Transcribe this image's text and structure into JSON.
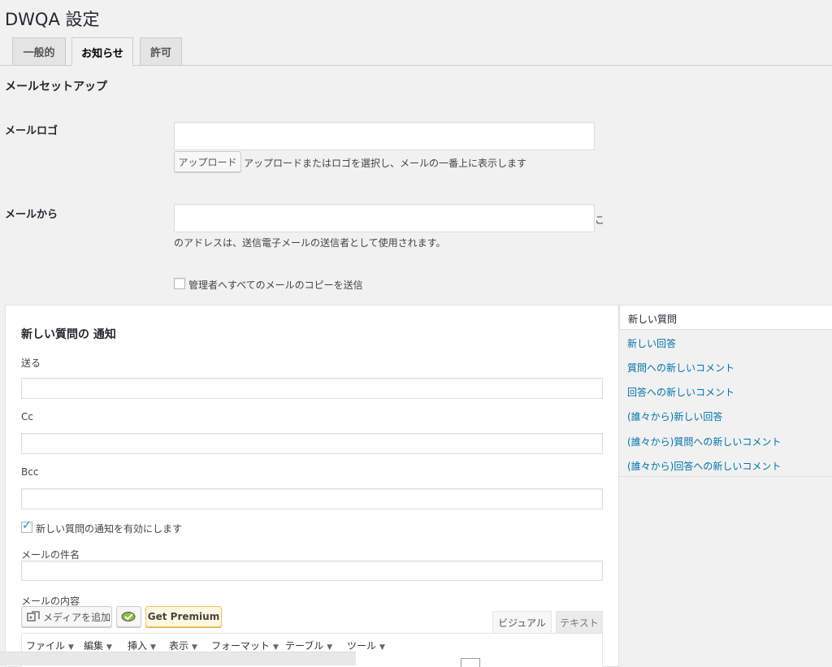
{
  "header": {
    "title": "DWQA  設定"
  },
  "tabs": [
    {
      "label": "一般的",
      "active": false
    },
    {
      "label": "お知らせ",
      "active": true
    },
    {
      "label": "許可",
      "active": false
    }
  ],
  "mail_setup": {
    "heading": "メールセットアップ",
    "logo_label": "メールロゴ",
    "logo_value": "",
    "upload_button": "アップロード",
    "upload_desc": "アップロードまたはロゴを選択し、メールの一番上に表示します",
    "from_label": "メールから",
    "from_value": "",
    "from_desc_tail": "こ",
    "from_desc": "のアドレスは、送信電子メールの送信者として使用されます。",
    "copy_admin_label": "管理者へすべてのメールのコピーを送信",
    "copy_admin_checked": false
  },
  "notification_tabs": [
    {
      "label": "新しい質問",
      "active": true
    },
    {
      "label": "新しい回答",
      "active": false
    },
    {
      "label": "質問への新しいコメント",
      "active": false
    },
    {
      "label": "回答への新しいコメント",
      "active": false
    },
    {
      "label": "(誰々から)新しい回答",
      "active": false
    },
    {
      "label": "(誰々から)質問への新しいコメント",
      "active": false
    },
    {
      "label": "(誰々から)回答への新しいコメント",
      "active": false
    }
  ],
  "notification": {
    "title": "新しい質問の 通知",
    "to_label": "送る",
    "to_value": "",
    "cc_label": "Cc",
    "cc_value": "",
    "bcc_label": "Bcc",
    "bcc_value": "",
    "enable_label": "新しい質問の通知を有効にします",
    "enable_checked": true,
    "subject_label": "メールの件名",
    "subject_value": "",
    "content_label": "メールの内容"
  },
  "editor": {
    "add_media": "メディアを追加",
    "get_premium": "Get Premium",
    "visual_tab": "ビジュアル",
    "text_tab": "テキスト",
    "menu": [
      "ファイル",
      "編集",
      "挿入",
      "表示",
      "フォーマット",
      "テーブル",
      "ツール"
    ]
  },
  "colors": {
    "link": "#0073aa",
    "check": "#1e8cbe",
    "premium_border": "#f0c36d",
    "premium_bg": "#fff8e1"
  }
}
